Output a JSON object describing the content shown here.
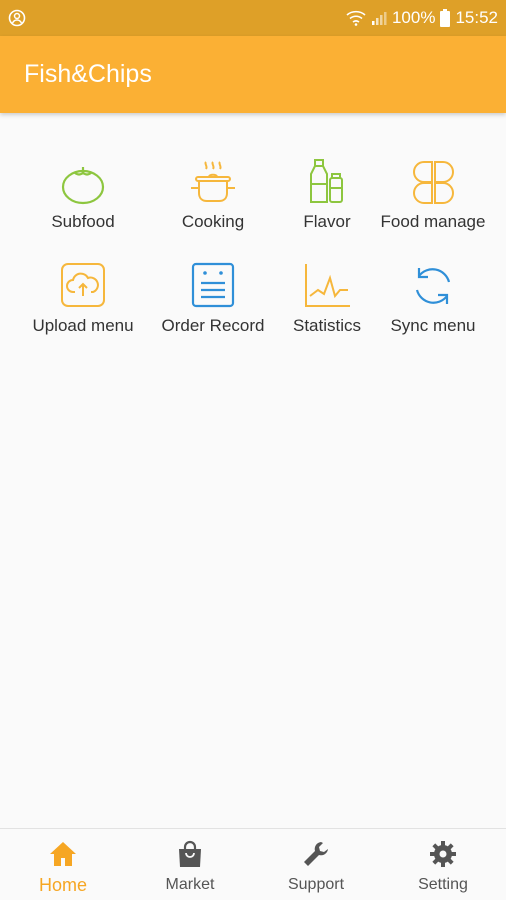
{
  "status_bar": {
    "battery": "100%",
    "time": "15:52"
  },
  "app_bar": {
    "title": "Fish&Chips"
  },
  "menu": [
    {
      "label": "Subfood",
      "icon": "tomato-icon",
      "color": "#8dc63f"
    },
    {
      "label": "Cooking",
      "icon": "cooking-pot-icon",
      "color": "#f6b73c"
    },
    {
      "label": "Flavor",
      "icon": "condiment-bottles-icon",
      "color": "#8dc63f"
    },
    {
      "label": "Food manage",
      "icon": "four-petal-icon",
      "color": "#f6b73c"
    },
    {
      "label": "Upload menu",
      "icon": "cloud-upload-icon",
      "color": "#f6b73c"
    },
    {
      "label": "Order Record",
      "icon": "order-record-icon",
      "color": "#2f8fd8"
    },
    {
      "label": "Statistics",
      "icon": "line-chart-icon",
      "color": "#f6b73c"
    },
    {
      "label": "Sync menu",
      "icon": "sync-icon",
      "color": "#2f8fd8"
    }
  ],
  "bottom_nav": [
    {
      "label": "Home",
      "icon": "home-icon",
      "active": true
    },
    {
      "label": "Market",
      "icon": "shopping-bag-icon"
    },
    {
      "label": "Support",
      "icon": "wrench-icon"
    },
    {
      "label": "Setting",
      "icon": "gear-icon"
    }
  ],
  "colors": {
    "app_bar": "#fbb034",
    "status_bar": "#dea028",
    "active_nav": "#f6a623",
    "inactive_nav": "#555555"
  }
}
